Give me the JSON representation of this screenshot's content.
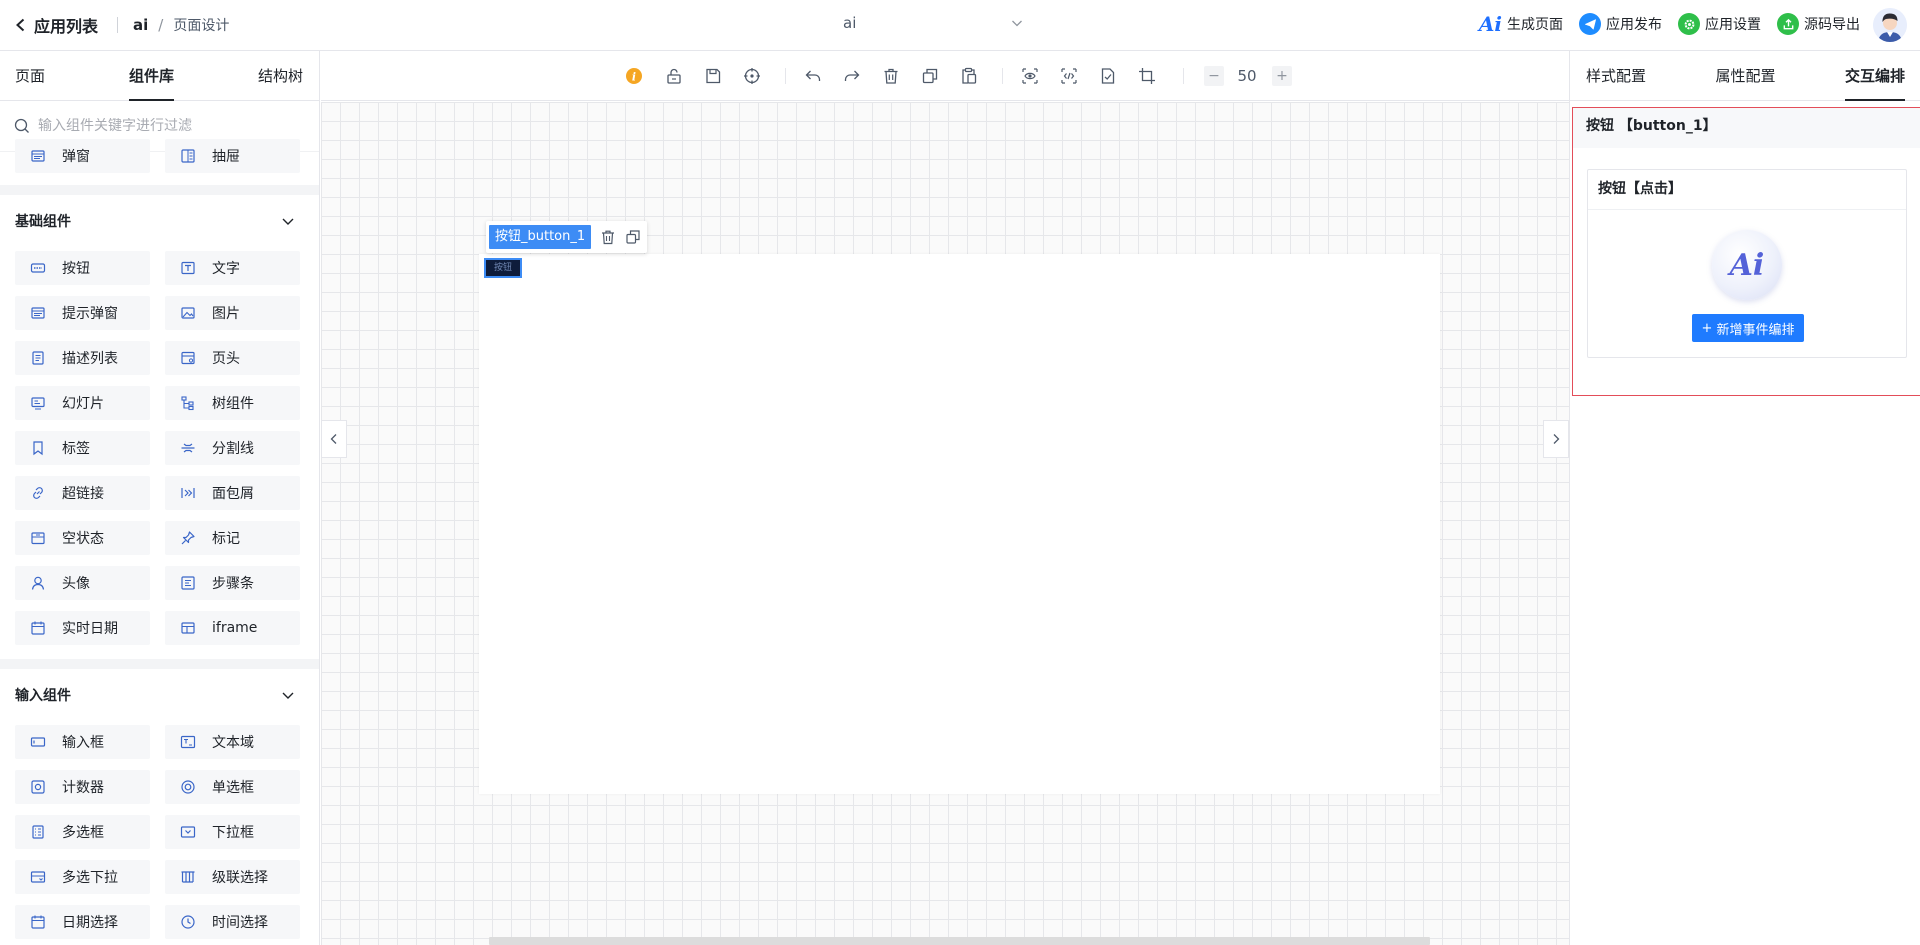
{
  "topbar": {
    "back_label": "应用列表",
    "app_name": "ai",
    "separator": "/",
    "page_name": "页面设计",
    "app_select_value": "ai",
    "actions": {
      "generate": "生成页面",
      "publish": "应用发布",
      "settings": "应用设置",
      "export": "源码导出"
    },
    "colors": {
      "publish": "#1e8cff",
      "settings": "#2fbf4a",
      "export": "#2fbf4a",
      "ai": "#1e6fff"
    }
  },
  "left_panel": {
    "tabs": [
      "页面",
      "组件库",
      "结构树"
    ],
    "active_tab": "组件库",
    "search_placeholder": "输入组件关键字进行过滤",
    "top_items": [
      {
        "label": "弹窗",
        "icon": "modal-icon"
      },
      {
        "label": "抽屉",
        "icon": "drawer-icon"
      }
    ],
    "groups": [
      {
        "title": "基础组件",
        "items": [
          {
            "label": "按钮",
            "icon": "button-icon"
          },
          {
            "label": "文字",
            "icon": "text-icon"
          },
          {
            "label": "提示弹窗",
            "icon": "alert-modal-icon"
          },
          {
            "label": "图片",
            "icon": "image-icon"
          },
          {
            "label": "描述列表",
            "icon": "description-list-icon"
          },
          {
            "label": "页头",
            "icon": "page-header-icon"
          },
          {
            "label": "幻灯片",
            "icon": "slides-icon"
          },
          {
            "label": "树组件",
            "icon": "tree-icon"
          },
          {
            "label": "标签",
            "icon": "tag-icon"
          },
          {
            "label": "分割线",
            "icon": "divider-icon"
          },
          {
            "label": "超链接",
            "icon": "link-icon"
          },
          {
            "label": "面包屑",
            "icon": "breadcrumb-icon"
          },
          {
            "label": "空状态",
            "icon": "empty-icon"
          },
          {
            "label": "标记",
            "icon": "pin-icon"
          },
          {
            "label": "头像",
            "icon": "avatar-icon"
          },
          {
            "label": "步骤条",
            "icon": "steps-icon"
          },
          {
            "label": "实时日期",
            "icon": "calendar-icon"
          },
          {
            "label": "iframe",
            "icon": "iframe-icon"
          }
        ]
      },
      {
        "title": "输入组件",
        "items": [
          {
            "label": "输入框",
            "icon": "input-icon"
          },
          {
            "label": "文本域",
            "icon": "textarea-icon"
          },
          {
            "label": "计数器",
            "icon": "counter-icon"
          },
          {
            "label": "单选框",
            "icon": "radio-icon"
          },
          {
            "label": "多选框",
            "icon": "checkbox-icon"
          },
          {
            "label": "下拉框",
            "icon": "select-icon"
          },
          {
            "label": "多选下拉",
            "icon": "multi-select-icon"
          },
          {
            "label": "级联选择",
            "icon": "cascader-icon"
          },
          {
            "label": "日期选择",
            "icon": "date-picker-icon"
          },
          {
            "label": "时间选择",
            "icon": "time-picker-icon"
          }
        ]
      }
    ]
  },
  "toolbar": {
    "zoom_minus": "−",
    "zoom_value": "50",
    "zoom_plus": "+"
  },
  "canvas": {
    "selected_label": "按钮_button_1",
    "mini_button_text": "按钮"
  },
  "right_panel": {
    "tabs": [
      "样式配置",
      "属性配置",
      "交互编排"
    ],
    "active_tab": "交互编排",
    "component_title": "按钮 【button_1】",
    "event_title": "按钮【点击】",
    "ai_badge_text": "Ai",
    "add_event_label": "新增事件编排",
    "colors": {
      "highlight_border": "#e34d59",
      "primary": "#1f7bff"
    }
  }
}
